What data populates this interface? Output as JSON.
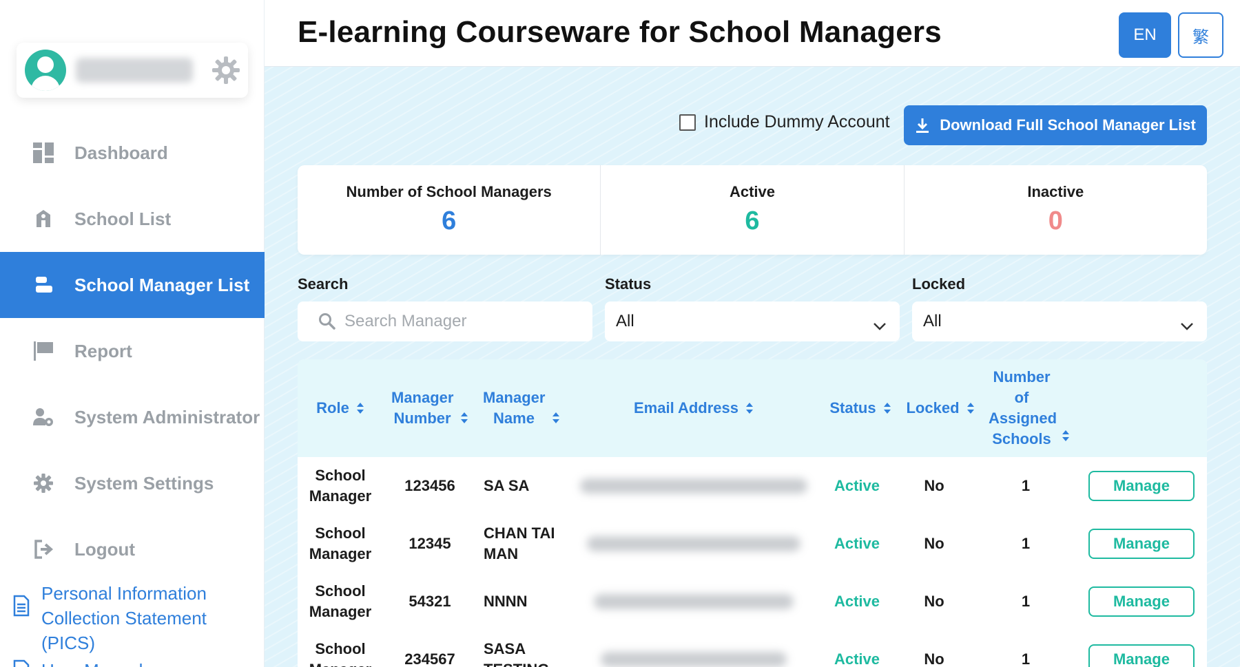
{
  "header": {
    "title": "E-learning Courseware for School Managers",
    "lang_en": "EN",
    "lang_zh": "繁"
  },
  "sidebar": {
    "items": [
      {
        "label": "Dashboard",
        "icon": "dashboard-icon"
      },
      {
        "label": "School List",
        "icon": "school-icon"
      },
      {
        "label": "School Manager List",
        "icon": "manager-list-icon",
        "active": true
      },
      {
        "label": "Report",
        "icon": "flag-icon"
      },
      {
        "label": "System Administrator",
        "icon": "user-cog-icon"
      },
      {
        "label": "System Settings",
        "icon": "gear-icon"
      },
      {
        "label": "Logout",
        "icon": "logout-icon"
      }
    ],
    "links": [
      {
        "label": "Personal Information Collection Statement (PICS)",
        "icon": "document-icon"
      },
      {
        "label": "User Manual",
        "icon": "document-icon"
      }
    ]
  },
  "toolbar": {
    "dummy_label": "Include Dummy Account",
    "download_label": "Download Full School Manager List"
  },
  "stats": [
    {
      "label": "Number of School Managers",
      "value": "6",
      "color": "#2f7fdb"
    },
    {
      "label": "Active",
      "value": "6",
      "color": "#1ebaa0"
    },
    {
      "label": "Inactive",
      "value": "0",
      "color": "#f08a8a"
    }
  ],
  "filters": {
    "search_label": "Search",
    "search_placeholder": "Search Manager",
    "status_label": "Status",
    "status_value": "All",
    "locked_label": "Locked",
    "locked_value": "All"
  },
  "table": {
    "columns": {
      "role": "Role",
      "manager_number": "Manager Number",
      "manager_name": "Manager Name",
      "email": "Email Address",
      "status": "Status",
      "locked": "Locked",
      "schools": "Number of Assigned Schools"
    },
    "rows": [
      {
        "role": "School Manager",
        "number": "123456",
        "name": "SA SA",
        "status": "Active",
        "locked": "No",
        "schools": "1",
        "action": "Manage"
      },
      {
        "role": "School Manager",
        "number": "12345",
        "name": "CHAN TAI MAN",
        "status": "Active",
        "locked": "No",
        "schools": "1",
        "action": "Manage"
      },
      {
        "role": "School Manager",
        "number": "54321",
        "name": "NNNN",
        "status": "Active",
        "locked": "No",
        "schools": "1",
        "action": "Manage"
      },
      {
        "role": "School Manager",
        "number": "234567",
        "name": "SASA TESTING",
        "status": "Active",
        "locked": "No",
        "schools": "1",
        "action": "Manage"
      }
    ]
  },
  "colors": {
    "primary": "#2f7fdb",
    "active": "#1ebaa0",
    "inactive": "#f08a8a"
  }
}
